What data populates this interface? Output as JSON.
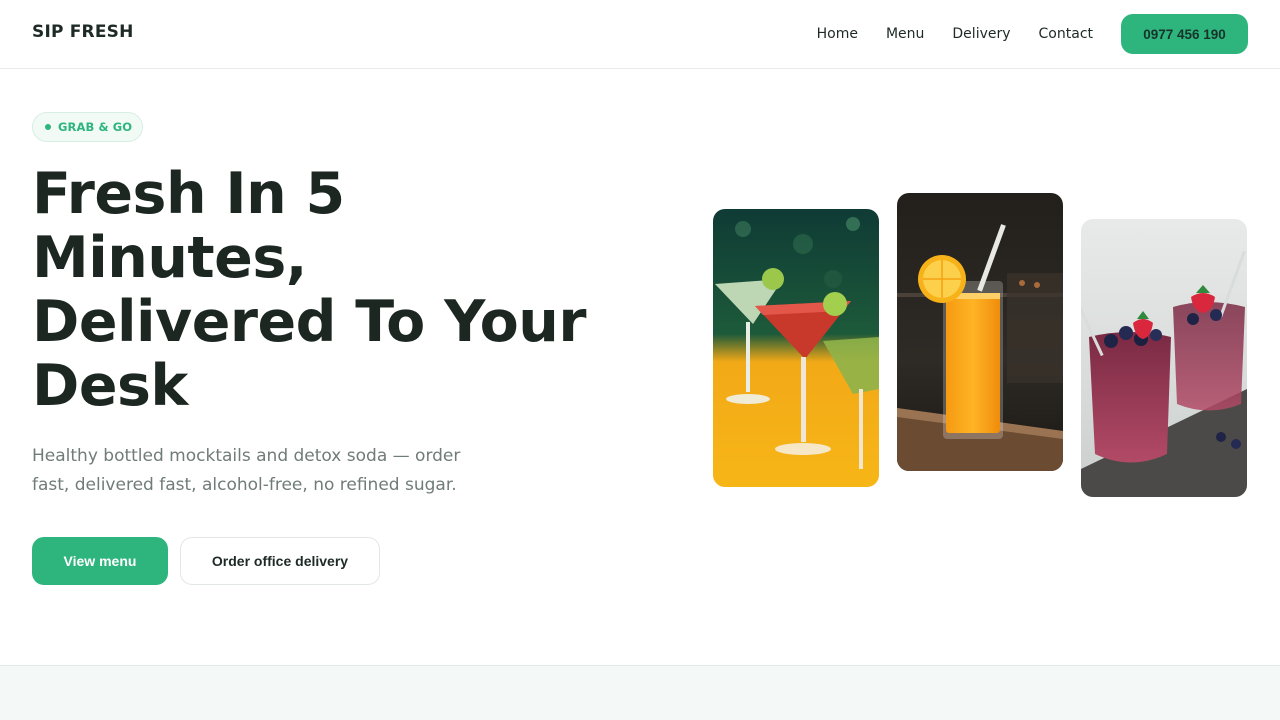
{
  "brand": "SIP FRESH",
  "nav": {
    "items": [
      {
        "label": "Home"
      },
      {
        "label": "Menu"
      },
      {
        "label": "Delivery"
      },
      {
        "label": "Contact"
      }
    ],
    "phone": "0977 456 190"
  },
  "hero": {
    "badge": "GRAB & GO",
    "title_lines": [
      "Fresh In 5",
      "Minutes,",
      "Delivered To Your",
      "Desk"
    ],
    "subtitle": "Healthy bottled mocktails and detox soda — order fast, delivered fast, alcohol-free, no refined sugar.",
    "cta_primary": "View menu",
    "cta_secondary": "Order office delivery"
  },
  "gallery": {
    "images": [
      {
        "icon": "mocktail-glasses-image"
      },
      {
        "icon": "orange-juice-image"
      },
      {
        "icon": "berry-smoothie-image"
      }
    ]
  },
  "colors": {
    "accent": "#2eb57e",
    "text": "#1c2722",
    "muted": "#707c77"
  }
}
